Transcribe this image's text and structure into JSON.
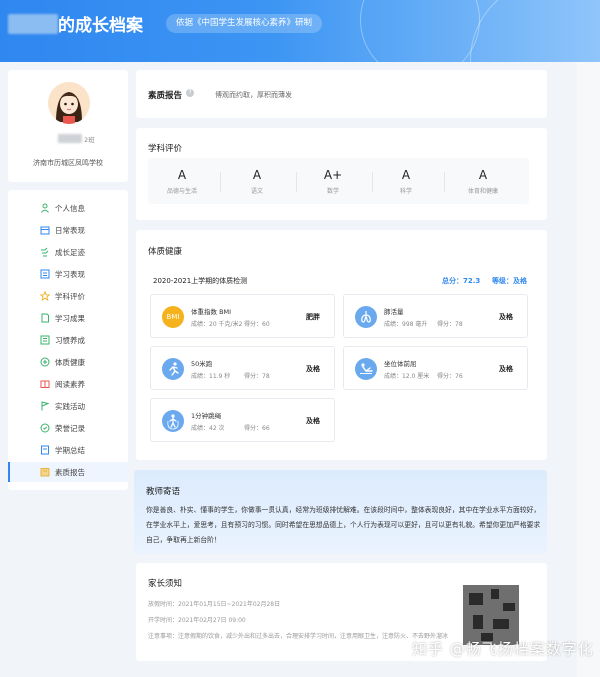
{
  "header": {
    "title": "的成长档案",
    "subtitle": "依据《中国学生发展核心素养》研制"
  },
  "profile": {
    "name_suffix": "2班",
    "school": "济南市历城区凤鸣学校"
  },
  "sidebar": {
    "items": [
      {
        "label": "个人信息",
        "icon": "person-icon"
      },
      {
        "label": "日常表现",
        "icon": "calendar-icon"
      },
      {
        "label": "成长足迹",
        "icon": "footprint-icon"
      },
      {
        "label": "学习表现",
        "icon": "study-icon"
      },
      {
        "label": "学科评价",
        "icon": "star-icon"
      },
      {
        "label": "学习成果",
        "icon": "document-icon"
      },
      {
        "label": "习惯养成",
        "icon": "list-icon"
      },
      {
        "label": "体质健康",
        "icon": "health-icon"
      },
      {
        "label": "阅读素养",
        "icon": "book-icon"
      },
      {
        "label": "实践活动",
        "icon": "flag-icon"
      },
      {
        "label": "荣誉记录",
        "icon": "medal-icon"
      },
      {
        "label": "学期总结",
        "icon": "summary-icon"
      },
      {
        "label": "素质报告",
        "icon": "report-icon"
      }
    ],
    "active_index": 12
  },
  "report": {
    "title": "素质报告",
    "motto": "博观而约取，厚积而薄发"
  },
  "grades": {
    "title": "学科评价",
    "items": [
      {
        "value": "A",
        "name": "品德与生活"
      },
      {
        "value": "A",
        "name": "语文"
      },
      {
        "value": "A+",
        "name": "数学"
      },
      {
        "value": "A",
        "name": "科学"
      },
      {
        "value": "A",
        "name": "体育和健康"
      }
    ]
  },
  "health": {
    "title": "体质健康",
    "term": "2020-2021上学期的体质检测",
    "total": "总分：72.3",
    "grade": "等级：及格",
    "items": [
      {
        "name": "体重指数 BMI",
        "result": "成绩：20 千克/米2",
        "score": "得分：60",
        "level": "肥胖",
        "icon": "BMI"
      },
      {
        "name": "肺活量",
        "result": "成绩：998 毫升",
        "score": "得分：78",
        "level": "及格",
        "icon": "lungs-icon"
      },
      {
        "name": "50米跑",
        "result": "成绩：11.9 秒",
        "score": "得分：78",
        "level": "及格",
        "icon": "runner-icon"
      },
      {
        "name": "坐位体前屈",
        "result": "成绩：12.0 厘米",
        "score": "得分：76",
        "level": "及格",
        "icon": "stretch-icon"
      },
      {
        "name": "1分钟跳绳",
        "result": "成绩：42 次",
        "score": "得分：66",
        "level": "及格",
        "icon": "jumprope-icon"
      }
    ]
  },
  "teacher": {
    "title": "教师寄语",
    "text": "你是善良、朴实、懂事的学生，你做事一贯认真，经常为班级排忧解难。在该段时间中，整体表现良好，其中在学业水平方面较好，在学业水平上，爱思考，且有预习的习惯。同时希望在思想品德上，个人行为表现可以更好，且可以更有礼貌。希望你更加严格要求自己，争取再上新台阶！"
  },
  "parent": {
    "title": "家长须知",
    "rows": [
      "放假时间：2021年01月15日~2021年02月28日",
      "开学时间：2021年02月27日 09:00",
      "注意事项：注意假期的饮食，减少外出和过多出去，合理安排学习时间，注意用眼卫生，注意防火、不去野外溜冰"
    ]
  },
  "watermark": "知乎 @畅飞扬档案数字化",
  "colors": {
    "primary": "#2f87f0",
    "header_gradient_end": "#8fc5fa",
    "bmi_orange": "#f6b21c",
    "icon_blue": "#6aa9ee"
  }
}
